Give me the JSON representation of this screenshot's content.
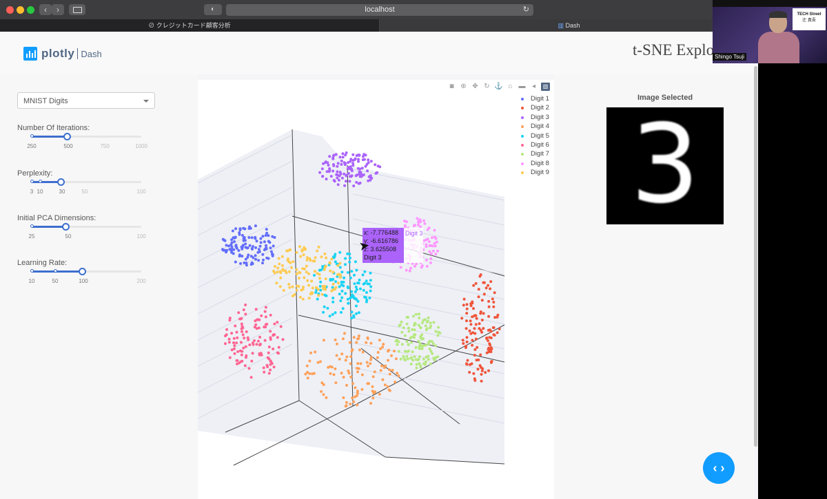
{
  "browser": {
    "url": "localhost",
    "tabs": [
      {
        "label": "クレジットカード顧客分析",
        "active": false
      },
      {
        "label": "Dash",
        "active": true
      }
    ]
  },
  "overlay": {
    "presenter_name": "Shingo Tsuji",
    "card_title": "TECH Street",
    "card_subtitle": "辻 真吾"
  },
  "header": {
    "logo_text": "plotly",
    "logo_sub": "Dash",
    "title": "t-SNE Explo"
  },
  "controls": {
    "dataset": "MNIST Digits",
    "iterations": {
      "label": "Number Of Iterations:",
      "ticks": [
        "250",
        "500",
        "750",
        "1000"
      ],
      "value": "500"
    },
    "perplexity": {
      "label": "Perplexity:",
      "ticks": [
        "3",
        "10",
        "30",
        "50",
        "100"
      ],
      "value": "30"
    },
    "pca": {
      "label": "Initial PCA Dimensions:",
      "ticks": [
        "25",
        "50",
        "100"
      ],
      "value": "50"
    },
    "learning_rate": {
      "label": "Learning Rate:",
      "ticks": [
        "10",
        "50",
        "100",
        "200"
      ],
      "value": "100"
    }
  },
  "plot": {
    "legend": [
      {
        "name": "Digit 1",
        "color": "#636efa"
      },
      {
        "name": "Digit 2",
        "color": "#ef553b"
      },
      {
        "name": "Digit 3",
        "color": "#ab63fa"
      },
      {
        "name": "Digit 4",
        "color": "#ffa15a"
      },
      {
        "name": "Digit 5",
        "color": "#19d3f3"
      },
      {
        "name": "Digit 6",
        "color": "#ff6692"
      },
      {
        "name": "Digit 7",
        "color": "#b6e880"
      },
      {
        "name": "Digit 8",
        "color": "#ff97ff"
      },
      {
        "name": "Digit 9",
        "color": "#fecb52"
      }
    ],
    "hover": {
      "x": "x: -7.776488",
      "y": "y: -6.616786",
      "z": "z: 3.625508",
      "label": "Digit 3",
      "name": "Digit 3"
    }
  },
  "image_panel": {
    "title": "Image Selected",
    "digit": "3"
  }
}
